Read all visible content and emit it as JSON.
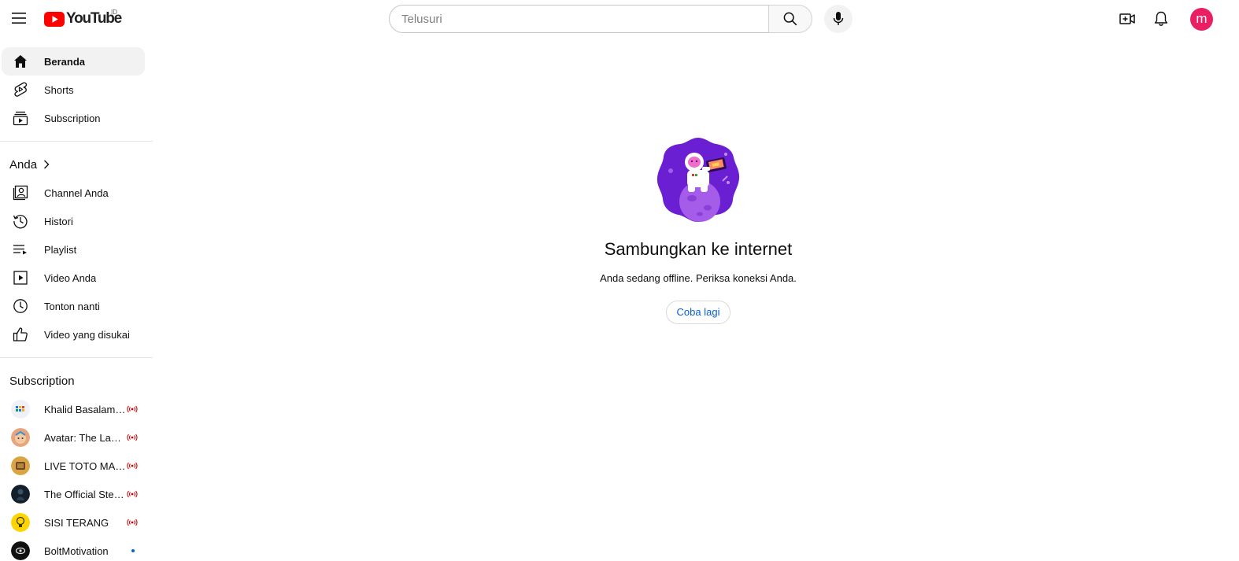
{
  "header": {
    "logo_text": "YouTube",
    "country_code": "ID",
    "search_placeholder": "Telusuri",
    "avatar_letter": "m",
    "avatar_color": "#e91e63"
  },
  "sidebar": {
    "main_items": [
      {
        "label": "Beranda",
        "icon": "home-icon",
        "active": true
      },
      {
        "label": "Shorts",
        "icon": "shorts-icon",
        "active": false
      },
      {
        "label": "Subscription",
        "icon": "subscriptions-icon",
        "active": false
      }
    ],
    "you_section": {
      "title": "Anda",
      "items": [
        {
          "label": "Channel Anda",
          "icon": "your-channel-icon"
        },
        {
          "label": "Histori",
          "icon": "history-icon"
        },
        {
          "label": "Playlist",
          "icon": "playlist-icon"
        },
        {
          "label": "Video Anda",
          "icon": "your-videos-icon"
        },
        {
          "label": "Tonton nanti",
          "icon": "watch-later-icon"
        },
        {
          "label": "Video yang disukai",
          "icon": "liked-videos-icon"
        }
      ]
    },
    "subscriptions": {
      "title": "Subscription",
      "items": [
        {
          "label": "Khalid Basalamah Official",
          "status": "live"
        },
        {
          "label": "Avatar: The Last Airbender",
          "status": "live"
        },
        {
          "label": "LIVE TOTO MACAU",
          "status": "live"
        },
        {
          "label": "The Official Steve Harvey",
          "status": "live"
        },
        {
          "label": "SISI TERANG",
          "status": "live"
        },
        {
          "label": "BoltMotivation",
          "status": "new"
        }
      ]
    }
  },
  "main": {
    "title": "Sambungkan ke internet",
    "description": "Anda sedang offline. Periksa koneksi Anda.",
    "retry_label": "Coba lagi"
  },
  "colors": {
    "brand_red": "#ff0000",
    "link_blue": "#065fd4",
    "live_red": "#cc0000"
  }
}
